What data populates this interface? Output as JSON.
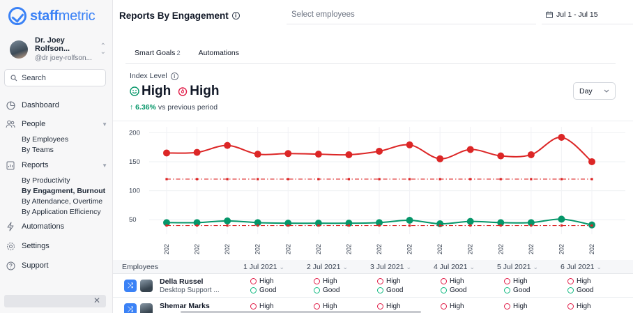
{
  "app": {
    "logo_bold": "staff",
    "logo_light": "metric",
    "brand_color": "#3b82f6"
  },
  "user": {
    "name": "Dr. Joey Rolfson...",
    "handle": "@dr joey-rolfson..."
  },
  "sidebar": {
    "search_placeholder": "Search",
    "items": [
      {
        "label": "Dashboard",
        "icon": "pie-chart-icon"
      },
      {
        "label": "People",
        "icon": "people-icon",
        "subitems": [
          "By Employees",
          "By Teams"
        ]
      },
      {
        "label": "Reports",
        "icon": "report-icon",
        "subitems": [
          "By Productivity",
          "By Engagment, Burnout",
          "By Attendance, Overtime",
          "By Application Efficiency"
        ]
      },
      {
        "label": "Automations",
        "icon": "lightning-icon"
      },
      {
        "label": "Settings",
        "icon": "gear-icon"
      },
      {
        "label": "Support",
        "icon": "help-icon"
      }
    ]
  },
  "header": {
    "title": "Reports By Engagement",
    "employee_placeholder": "Select employees",
    "date_range": "Jul 1 - Jul 15"
  },
  "tabs": [
    {
      "label": "Smart Goals",
      "count": "2"
    },
    {
      "label": "Automations",
      "count": ""
    }
  ],
  "summary": {
    "index_label": "Index Level",
    "level_1": "High",
    "level_2": "High",
    "change_pct": "6.36%",
    "change_text": "vs previous period",
    "period_select": "Day"
  },
  "chart_data": {
    "type": "line",
    "y_ticks": [
      200,
      150,
      100,
      50
    ],
    "ylim": [
      25,
      210
    ],
    "x_tick_label": "202",
    "x_count": 15,
    "grid": true,
    "series": [
      {
        "color": "#dc2626",
        "style": "solid",
        "values": [
          165,
          166,
          178,
          163,
          164,
          163,
          162,
          168,
          179,
          155,
          171,
          160,
          162,
          192,
          150
        ]
      },
      {
        "color": "#dc2626",
        "style": "dash-dot",
        "values": [
          120,
          120,
          120,
          120,
          120,
          120,
          120,
          120,
          120,
          120,
          120,
          120,
          120,
          120,
          120
        ]
      },
      {
        "color": "#059669",
        "style": "solid",
        "values": [
          45,
          45,
          48,
          45,
          44,
          44,
          44,
          45,
          49,
          43,
          47,
          45,
          45,
          51,
          41
        ]
      },
      {
        "color": "#dc2626",
        "style": "dash-dot",
        "values": [
          40,
          40,
          40,
          40,
          40,
          40,
          40,
          40,
          40,
          40,
          40,
          40,
          40,
          40,
          40
        ]
      }
    ]
  },
  "table": {
    "employees_header": "Employees",
    "date_headers": [
      "1 Jul 2021",
      "2 Jul 2021",
      "3 Jul 2021",
      "4 Jul 2021",
      "5 Jul 2021",
      "6 Jul 2021"
    ],
    "rows": [
      {
        "name": "Della Russel",
        "role": "Desktop Support ...",
        "cells": [
          {
            "burnout": "High",
            "engagement": "Good"
          },
          {
            "burnout": "High",
            "engagement": "Good"
          },
          {
            "burnout": "High",
            "engagement": "Good"
          },
          {
            "burnout": "High",
            "engagement": "Good"
          },
          {
            "burnout": "High",
            "engagement": "Good"
          },
          {
            "burnout": "High",
            "engagement": "Good"
          }
        ]
      },
      {
        "name": "Shemar Marks",
        "role": "",
        "cells": [
          {
            "burnout": "High"
          },
          {
            "burnout": "High"
          },
          {
            "burnout": "High"
          },
          {
            "burnout": "High"
          },
          {
            "burnout": "High"
          },
          {
            "burnout": "High"
          }
        ]
      }
    ]
  }
}
